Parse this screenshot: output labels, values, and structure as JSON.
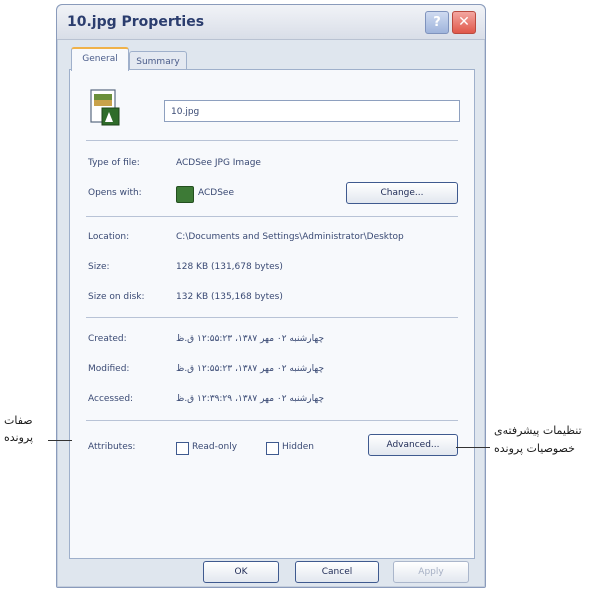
{
  "window": {
    "title": "10.jpg Properties",
    "help_label": "?",
    "close_label": "✕"
  },
  "tabs": [
    {
      "label": "General"
    },
    {
      "label": "Summary"
    }
  ],
  "file": {
    "name": "10.jpg",
    "icon": "jpg-file-icon"
  },
  "props": {
    "type_label": "Type of file:",
    "type_value": "ACDSee JPG Image",
    "opens_label": "Opens with:",
    "opens_value": "ACDSee",
    "opens_icon": "acdsee-app-icon",
    "change_label": "Change...",
    "location_label": "Location:",
    "location_value": "C:\\Documents and Settings\\Administrator\\Desktop",
    "size_label": "Size:",
    "size_value": "128 KB (131,678 bytes)",
    "sizeondisk_label": "Size on disk:",
    "sizeondisk_value": "132 KB (135,168 bytes)",
    "created_label": "Created:",
    "created_value": "چهارشنبه ۰۲ مهر ۱۳۸۷، ۱۲:۵۵:۲۳ ق.ظ",
    "modified_label": "Modified:",
    "modified_value": "چهارشنبه ۰۲ مهر ۱۳۸۷، ۱۲:۵۵:۲۳ ق.ظ",
    "accessed_label": "Accessed:",
    "accessed_value": "چهارشنبه ۰۲ مهر ۱۳۸۷، ۱۲:۳۹:۲۹ ق.ظ",
    "attributes_label": "Attributes:",
    "readonly_label": "Read-only",
    "hidden_label": "Hidden",
    "advanced_label": "Advanced..."
  },
  "footer": {
    "ok_label": "OK",
    "cancel_label": "Cancel",
    "apply_label": "Apply"
  },
  "annotations": {
    "left_line1": "صفات",
    "left_line2": "پرونده",
    "right_line1": "تنظیمات پیشرفته‌ی",
    "right_line2": "خصوصیات پرونده"
  }
}
